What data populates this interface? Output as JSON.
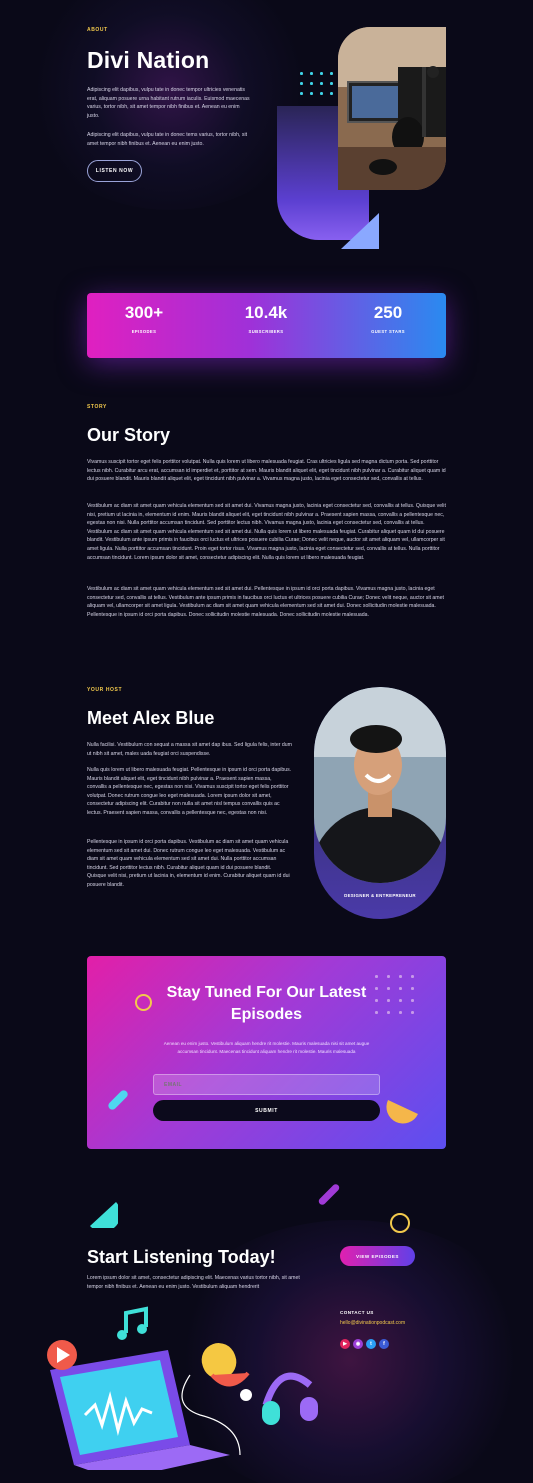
{
  "hero": {
    "eyebrow": "ABOUT",
    "title": "Divi Nation",
    "para1": "Adipiscing elit dapibus, vulpu tate in donec tempor ultricies venenatis erat, aliquam posuere urna habitant rutrum iaculis. Euismod maecenas varius, tortor nibh, sit amet tempor nibh finibus et. Aenean eu enim justo.",
    "para2": "Adipiscing elit dapibus, vulpu tate in donec tems varius, tortor nibh, sit amet tempor nibh finibus et. Aenean eu enim justo.",
    "listen_button": "LISTEN NOW"
  },
  "stats": [
    {
      "value": "300+",
      "label": "EPISODES"
    },
    {
      "value": "10.4k",
      "label": "SUBSCRIBERS"
    },
    {
      "value": "250",
      "label": "GUEST STARS"
    }
  ],
  "story": {
    "eyebrow": "STORY",
    "title": "Our Story",
    "p1": "Vivamus suscipit tortor eget felis porttitor volutpat. Nulla quis lorem ut libero malesuada feugiat. Cras ultricies ligula sed magna dictum porta. Sed porttitor lectus nibh. Curabitur arcu erat, accumsan id imperdiet et, porttitor at sem. Mauris blandit aliquet elit, eget tincidunt nibh pulvinar a. Curabitur aliquet quam id dui posuere blandit. Mauris blandit aliquet elit, eget tincidunt nibh pulvinar a. Vivamus magna justo, lacinia eget consectetur sed, convallis at tellus.",
    "p2": "Vestibulum ac diam sit amet quam vehicula elementum sed sit amet dui. Vivamus magna justo, lacinia eget consectetur sed, convallis at tellus. Quisque velit nisi, pretium ut lacinia in, elementum id enim. Mauris blandit aliquet elit, eget tincidunt nibh pulvinar a. Praesent sapien massa, convallis a pellentesque nec, egestas non nisi. Nulla porttitor accumsan tincidunt. Sed porttitor lectus nibh. Vivamus magna justo, lacinia eget consectetur sed, convallis at tellus. Vestibulum ac diam sit amet quam vehicula elementum sed sit amet dui. Nulla quis lorem ut libero malesuada feugiat. Curabitur aliquet quam id dui posuere blandit. Vestibulum ante ipsum primis in faucibus orci luctus et ultrices posuere cubilia Curae; Donec velit neque, auctor sit amet aliquam vel, ullamcorper sit amet ligula. Nulla porttitor accumsan tincidunt. Proin eget tortor risus. Vivamus magna justo, lacinia eget consectetur sed, convallis at tellus. Nulla porttitor accumsan tincidunt. Lorem ipsum dolor sit amet, consectetur adipiscing elit. Nulla quis lorem ut libero malesuada feugiat.",
    "p3": "Vestibulum ac diam sit amet quam vehicula elementum sed sit amet dui. Pellentesque in ipsum id orci porta dapibus. Vivamus magna justo, lacinia eget consectetur sed, convallis at tellus. Vestibulum ante ipsum primis in faucibus orci luctus et ultrices posuere cubilia Curae; Donec velit neque, auctor sit amet aliquam vel, ullamcorper sit amet ligula. Vestibulum ac diam sit amet quam vehicula elementum sed sit amet dui. Donec sollicitudin molestie malesuada. Pellentesque in ipsum id orci porta dapibus. Donec sollicitudin molestie malesuada. Donec sollicitudin molestie malesuada."
  },
  "host": {
    "eyebrow": "YOUR HOST",
    "title": "Meet Alex Blue",
    "p1": "Nulla facilisi. Vestibulum con sequat a massa sit amet dap ibus. Sed ligula felis, inter dum ut nibh sit amet, males uada feugiat orci suspendisse.",
    "p2": "Nulla quis lorem ut libero malesuada feugiat. Pellentesque in ipsum id orci porta dapibus. Mauris blandit aliquet elit, eget tincidunt nibh pulvinar a. Praesent sapien massa, convallis a pellentesque nec, egestas non nisi. Vivamus suscipit tortor eget felis porttitor volutpat. Donec rutrum congue leo eget malesuada. Lorem ipsum dolor sit amet, consectetur adipiscing elit. Curabitur non nulla sit amet nisl tempus convallis quis ac lectus. Praesent sapien massa, convallis a pellentesque nec, egestas non nisi.",
    "p3": "Pellentesque in ipsum id orci porta dapibus. Vestibulum ac diam sit amet quam vehicula elementum sed sit amet dui. Donec rutrum congue leo eget malesuada. Vestibulum ac diam sit amet quam vehicula elementum sed sit amet dui. Nulla porttitor accumsan tincidunt. Sed porttitor lectus nibh. Curabitur aliquet quam id dui posuere blandit. Quisque velit nisi, pretium ut lacinia in, elementum id enim. Curabitur aliquet quam id dui posuere blandit.",
    "caption": "DESIGNER & ENTREPRENEUR"
  },
  "subscribe": {
    "title_line1": "Stay Tuned For Our Latest",
    "title_line2": "Episodes",
    "text": "Aenean eu enim justo. Vestibulum aliquam hendre rit molestie. Mauris malesuada nisi sit amet augue accumsan tincidunt. Maecenas tincidunt aliquam hendre rit molestie. Mauris malesuada",
    "email_placeholder": "EMAIL",
    "submit_button": "SUBMIT"
  },
  "cta": {
    "title": "Start Listening Today!",
    "text": "Lorem ipsum dolor sit amet, consectetur adipiscing elit. Maecenas varius tortor nibh, sit amet tempor nibh finibus et. Aenean eu enim justo. Vestibulum aliquam hendrerit",
    "view_button": "VIEW EPISODES",
    "contact_heading": "CONTACT US",
    "contact_email": "hello@divinationpodcast.com"
  },
  "colors": {
    "accent_yellow": "#f2c94c",
    "gradient_pink": "#e020c0",
    "gradient_blue": "#2a8af0",
    "background": "#0a0918"
  },
  "icons": [
    "youtube-icon",
    "podcast-icon",
    "twitter-icon",
    "facebook-icon",
    "play-icon",
    "music-note-icon",
    "microphone-icon",
    "headphones-icon",
    "laptop-icon"
  ]
}
